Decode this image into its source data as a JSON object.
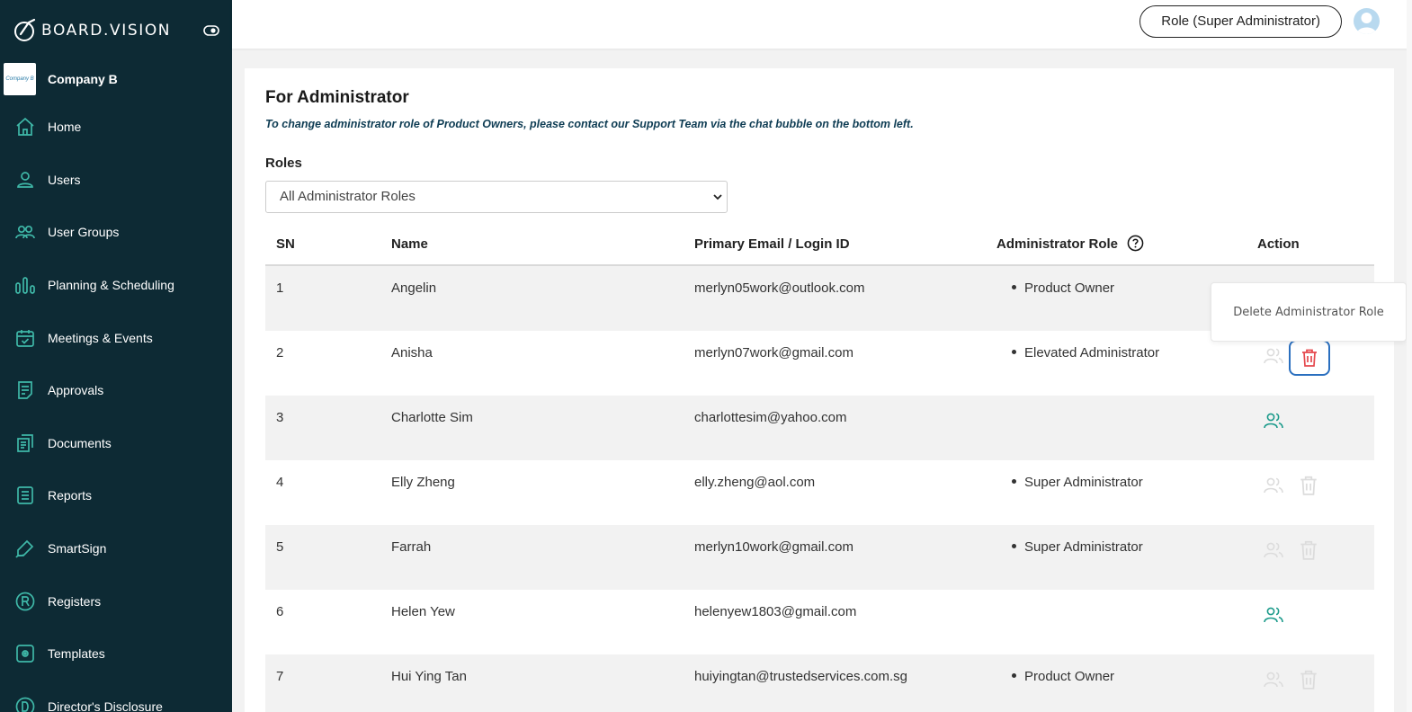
{
  "brand": {
    "name": "BOARD.VISION"
  },
  "company": {
    "name": "Company B",
    "logo_text": "Company B"
  },
  "sidebar": {
    "items": [
      {
        "label": "Home",
        "icon": "home-icon"
      },
      {
        "label": "Users",
        "icon": "user-icon"
      },
      {
        "label": "User Groups",
        "icon": "users-icon"
      },
      {
        "label": "Planning & Scheduling",
        "icon": "bar-chart-icon"
      },
      {
        "label": "Meetings & Events",
        "icon": "calendar-check-icon"
      },
      {
        "label": "Approvals",
        "icon": "document-list-icon"
      },
      {
        "label": "Documents",
        "icon": "documents-icon"
      },
      {
        "label": "Reports",
        "icon": "report-icon"
      },
      {
        "label": "SmartSign",
        "icon": "pen-icon"
      },
      {
        "label": "Registers",
        "icon": "registered-icon"
      },
      {
        "label": "Templates",
        "icon": "template-icon"
      },
      {
        "label": "Director's Disclosure",
        "icon": "disclosure-icon"
      }
    ]
  },
  "header": {
    "role_label": "Role (Super Administrator)"
  },
  "page": {
    "title": "For Administrator",
    "notice": "To change administrator role of Product Owners, please contact our Support Team via the chat bubble on the bottom left.",
    "roles_label": "Roles",
    "roles_selected": "All Administrator Roles"
  },
  "table": {
    "headers": {
      "sn": "SN",
      "name": "Name",
      "email": "Primary Email / Login ID",
      "role": "Administrator Role",
      "action": "Action"
    },
    "rows": [
      {
        "sn": "1",
        "name": "Angelin",
        "email": "merlyn05work@outlook.com",
        "role": "Product Owner",
        "actions": "hidden"
      },
      {
        "sn": "2",
        "name": "Anisha",
        "email": "merlyn07work@gmail.com",
        "role": "Elevated Administrator",
        "actions": "disabled-users-active-delete"
      },
      {
        "sn": "3",
        "name": "Charlotte Sim",
        "email": "charlottesim@yahoo.com",
        "role": "",
        "actions": "users-only"
      },
      {
        "sn": "4",
        "name": "Elly Zheng",
        "email": "elly.zheng@aol.com",
        "role": "Super Administrator",
        "actions": "disabled"
      },
      {
        "sn": "5",
        "name": "Farrah",
        "email": "merlyn10work@gmail.com",
        "role": "Super Administrator",
        "actions": "disabled"
      },
      {
        "sn": "6",
        "name": "Helen Yew",
        "email": "helenyew1803@gmail.com",
        "role": "",
        "actions": "users-only"
      },
      {
        "sn": "7",
        "name": "Hui Ying Tan",
        "email": "huiyingtan@trustedservices.com.sg",
        "role": "Product Owner",
        "actions": "disabled"
      }
    ]
  },
  "tooltip": {
    "text": "Delete Administrator Role"
  },
  "colors": {
    "sidebar_bg": "#0d2a34",
    "accent_teal": "#1a9a8a",
    "danger": "#e5484d",
    "focus": "#2a6fbf"
  }
}
